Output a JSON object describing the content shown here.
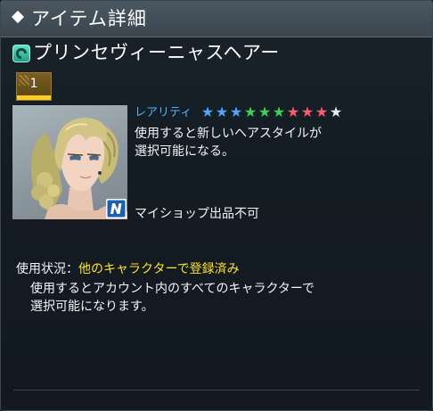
{
  "header": {
    "title": "アイテム詳細"
  },
  "item": {
    "name": "プリンセヴィーニャスヘアー",
    "type_icon": "hair-item-icon",
    "quantity": "1",
    "rarity_label": "レアリティ",
    "rarity": {
      "count": 10,
      "colors": [
        "#4aa8ff",
        "#4aa8ff",
        "#4aa8ff",
        "#3ed25a",
        "#3ed25a",
        "#3ed25a",
        "#ff5a6e",
        "#ff5a6e",
        "#ff5a6e",
        "#e8eef2"
      ]
    },
    "description_line1": "使用すると新しいヘアスタイルが",
    "description_line2": "選択可能になる。",
    "myshop_note": "マイショップ出品不可",
    "badge_icon": "n-badge-icon"
  },
  "usage": {
    "label": "使用状況：",
    "status": "他のキャラクターで登録済み",
    "detail_line1": "使用するとアカウント内のすべてのキャラクターで",
    "detail_line2": "選択可能になります。"
  },
  "colors": {
    "accent_blue": "#4cb4ff",
    "highlight_yellow": "#ffe31a",
    "header_bg": "#44515b"
  }
}
